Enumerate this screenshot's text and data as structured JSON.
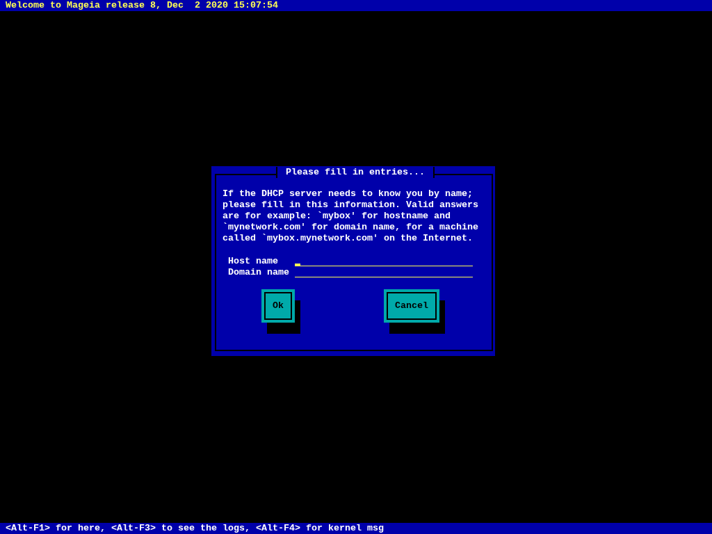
{
  "top_bar": {
    "text": "Welcome to Mageia release 8, Dec  2 2020 15:07:54"
  },
  "dialog": {
    "title": "Please fill in entries...",
    "message": "If the DHCP server needs to know you by name;\nplease fill in this information. Valid answers\nare for example: `mybox' for hostname and\n`mynetwork.com' for domain name, for a machine\ncalled `mybox.mynetwork.com' on the Internet.",
    "fields": [
      {
        "label": "Host name",
        "focused": true
      },
      {
        "label": "Domain name",
        "focused": false
      }
    ],
    "buttons": [
      {
        "label": "Ok"
      },
      {
        "label": "Cancel"
      }
    ]
  },
  "bottom_bar": {
    "text": "<Alt-F1> for here, <Alt-F3> to see the logs, <Alt-F4> for kernel msg"
  }
}
